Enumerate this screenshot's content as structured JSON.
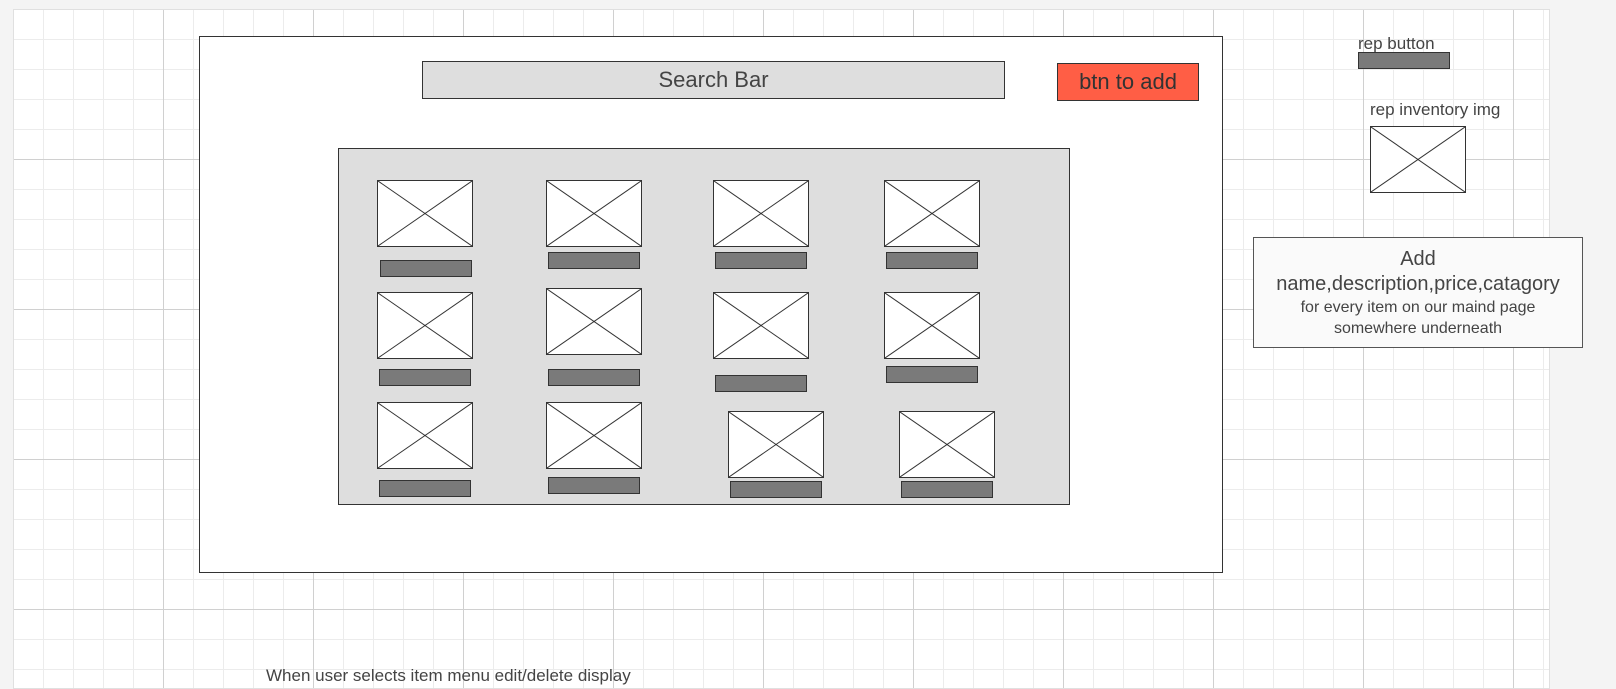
{
  "search_bar": {
    "label": "Search Bar"
  },
  "add_button": {
    "label": "btn to add",
    "color": "#ff5e45"
  },
  "legend": {
    "rep_button_label": "rep button",
    "rep_inventory_img_label": "rep inventory img"
  },
  "note": {
    "line1": "Add",
    "line2": "name,description,price,catagory",
    "line3": "for every item on our maind page",
    "line4": "somewhere underneath"
  },
  "bottom_text": "When user selects item menu edit/delete display",
  "grid": {
    "rows": 3,
    "columns": 4,
    "item_count": 12
  },
  "colors": {
    "panel": "#dedede",
    "item_button": "#7a7a7a",
    "canvas": "#ffffff"
  }
}
